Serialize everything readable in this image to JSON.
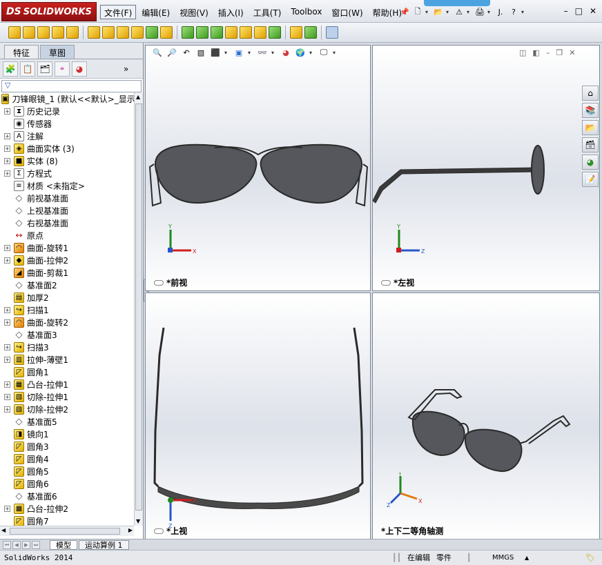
{
  "app": {
    "name": "SOLIDWORKS",
    "logo_prefix": "DS"
  },
  "menu": [
    "文件(F)",
    "编辑(E)",
    "视图(V)",
    "插入(I)",
    "工具(T)",
    "Toolbox",
    "窗口(W)",
    "帮助(H)"
  ],
  "quick": {
    "user": "J.",
    "help": "?"
  },
  "panel": {
    "tabs": [
      "特征",
      "草图"
    ],
    "filter_icon": "filter-icon",
    "tree": [
      {
        "label": "刀锋眼镜_1  (默认<<默认>_显示",
        "icon": "part-icon",
        "exp": false,
        "root": true
      },
      {
        "label": "历史记录",
        "icon": "history-icon",
        "exp": true
      },
      {
        "label": "传感器",
        "icon": "sensor-icon",
        "exp": false
      },
      {
        "label": "注解",
        "icon": "annotation-icon",
        "exp": true
      },
      {
        "label": "曲面实体 (3)",
        "icon": "surface-body-icon",
        "exp": true
      },
      {
        "label": "实体 (8)",
        "icon": "solid-body-icon",
        "exp": true
      },
      {
        "label": "方程式",
        "icon": "equation-icon",
        "exp": true
      },
      {
        "label": "材质 <未指定>",
        "icon": "material-icon",
        "exp": false
      },
      {
        "label": "前视基准面",
        "icon": "plane-icon",
        "exp": false
      },
      {
        "label": "上视基准面",
        "icon": "plane-icon",
        "exp": false
      },
      {
        "label": "右视基准面",
        "icon": "plane-icon",
        "exp": false
      },
      {
        "label": "原点",
        "icon": "origin-icon",
        "exp": false
      },
      {
        "label": "曲面-旋转1",
        "icon": "revolve-surface-icon",
        "exp": true
      },
      {
        "label": "曲面-拉伸2",
        "icon": "extrude-surface-icon",
        "exp": true
      },
      {
        "label": "曲面-剪裁1",
        "icon": "trim-surface-icon",
        "exp": false
      },
      {
        "label": "基准面2",
        "icon": "plane-icon",
        "exp": false
      },
      {
        "label": "加厚2",
        "icon": "thicken-icon",
        "exp": false
      },
      {
        "label": "扫描1",
        "icon": "sweep-icon",
        "exp": true
      },
      {
        "label": "曲面-旋转2",
        "icon": "revolve-surface-icon",
        "exp": true
      },
      {
        "label": "基准面3",
        "icon": "plane-icon",
        "exp": false
      },
      {
        "label": "扫描3",
        "icon": "sweep-icon",
        "exp": true
      },
      {
        "label": "拉伸-薄壁1",
        "icon": "extrude-thin-icon",
        "exp": true
      },
      {
        "label": "圆角1",
        "icon": "fillet-icon",
        "exp": false
      },
      {
        "label": "凸台-拉伸1",
        "icon": "boss-extrude-icon",
        "exp": true
      },
      {
        "label": "切除-拉伸1",
        "icon": "cut-extrude-icon",
        "exp": true
      },
      {
        "label": "切除-拉伸2",
        "icon": "cut-extrude-icon",
        "exp": true
      },
      {
        "label": "基准面5",
        "icon": "plane-icon",
        "exp": false
      },
      {
        "label": "镜向1",
        "icon": "mirror-icon",
        "exp": false
      },
      {
        "label": "圆角3",
        "icon": "fillet-icon",
        "exp": false
      },
      {
        "label": "圆角4",
        "icon": "fillet-icon",
        "exp": false
      },
      {
        "label": "圆角5",
        "icon": "fillet-icon",
        "exp": false
      },
      {
        "label": "圆角6",
        "icon": "fillet-icon",
        "exp": false
      },
      {
        "label": "基准面6",
        "icon": "plane-icon",
        "exp": false
      },
      {
        "label": "凸台-拉伸2",
        "icon": "boss-extrude-icon",
        "exp": true
      },
      {
        "label": "圆角7",
        "icon": "fillet-icon",
        "exp": false
      }
    ]
  },
  "viewports": {
    "front": {
      "label": "*前视"
    },
    "left": {
      "label": "*左视"
    },
    "top": {
      "label": "*上视"
    },
    "iso": {
      "label": "*上下二等角轴测"
    }
  },
  "axes": {
    "x": "X",
    "y": "Y",
    "z": "Z"
  },
  "bottom": {
    "tabs": [
      "模型",
      "运动算例 1"
    ]
  },
  "status": {
    "left": "SolidWorks 2014",
    "mode": "在编辑",
    "doc": "零件",
    "units": "MMGS"
  },
  "colors": {
    "lens": "#55575c",
    "frame": "#2a2a2a",
    "accent": "#c8211f"
  }
}
